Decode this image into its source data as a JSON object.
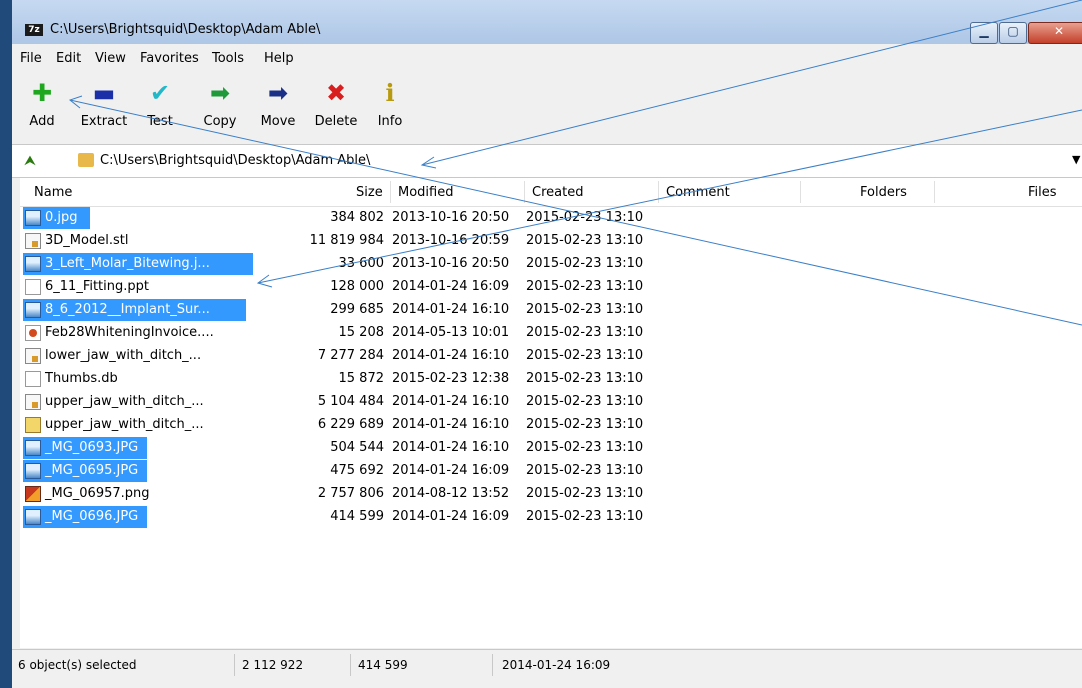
{
  "window": {
    "title": "C:\\Users\\Brightsquid\\Desktop\\Adam Able\\",
    "app_icon": "7z"
  },
  "menu": [
    "File",
    "Edit",
    "View",
    "Favorites",
    "Tools",
    "Help"
  ],
  "toolbar": [
    {
      "label": "Add",
      "icon": "plus-icon",
      "glyph": "✚",
      "color": "#1fa81f"
    },
    {
      "label": "Extract",
      "icon": "minus-icon",
      "glyph": "▬",
      "color": "#1a2fa8"
    },
    {
      "label": "Test",
      "icon": "check-icon",
      "glyph": "✔",
      "color": "#22b8c8"
    },
    {
      "label": "Copy",
      "icon": "copy-arrow-icon",
      "glyph": "➡",
      "color": "#1f9a3a"
    },
    {
      "label": "Move",
      "icon": "move-arrow-icon",
      "glyph": "➡",
      "color": "#1a2f88"
    },
    {
      "label": "Delete",
      "icon": "delete-x-icon",
      "glyph": "✖",
      "color": "#d81e1e"
    },
    {
      "label": "Info",
      "icon": "info-icon",
      "glyph": "ℹ",
      "color": "#b89a10"
    }
  ],
  "address": {
    "path": "C:\\Users\\Brightsquid\\Desktop\\Adam Able\\"
  },
  "columns": [
    "Name",
    "Size",
    "Modified",
    "Created",
    "Comment",
    "Folders",
    "Files"
  ],
  "files": [
    {
      "name": "0.jpg",
      "size": "384 802",
      "modified": "2013-10-16 20:50",
      "created": "2015-02-23 13:10",
      "type": "jpg",
      "selected": true
    },
    {
      "name": "3D_Model.stl",
      "size": "11 819 984",
      "modified": "2013-10-16 20:59",
      "created": "2015-02-23 13:10",
      "type": "stl",
      "selected": false
    },
    {
      "name": "3_Left_Molar_Bitewing.j...",
      "size": "33 600",
      "modified": "2013-10-16 20:50",
      "created": "2015-02-23 13:10",
      "type": "jpg",
      "selected": true
    },
    {
      "name": "6_11_Fitting.ppt",
      "size": "128 000",
      "modified": "2014-01-24 16:09",
      "created": "2015-02-23 13:10",
      "type": "ppt",
      "selected": false
    },
    {
      "name": "8_6_2012__Implant_Sur...",
      "size": "299 685",
      "modified": "2014-01-24 16:10",
      "created": "2015-02-23 13:10",
      "type": "jpg",
      "selected": true
    },
    {
      "name": "Feb28WhiteningInvoice....",
      "size": "15 208",
      "modified": "2014-05-13 10:01",
      "created": "2015-02-23 13:10",
      "type": "pdf",
      "selected": false
    },
    {
      "name": "lower_jaw_with_ditch_...",
      "size": "7 277 284",
      "modified": "2014-01-24 16:10",
      "created": "2015-02-23 13:10",
      "type": "stl",
      "selected": false
    },
    {
      "name": "Thumbs.db",
      "size": "15 872",
      "modified": "2015-02-23 12:38",
      "created": "2015-02-23 13:10",
      "type": "db",
      "selected": false
    },
    {
      "name": "upper_jaw_with_ditch_...",
      "size": "5 104 484",
      "modified": "2014-01-24 16:10",
      "created": "2015-02-23 13:10",
      "type": "stl",
      "selected": false
    },
    {
      "name": "upper_jaw_with_ditch_...",
      "size": "6 229 689",
      "modified": "2014-01-24 16:10",
      "created": "2015-02-23 13:10",
      "type": "zip",
      "selected": false
    },
    {
      "name": "_MG_0693.JPG",
      "size": "504 544",
      "modified": "2014-01-24 16:10",
      "created": "2015-02-23 13:10",
      "type": "jpg",
      "selected": true
    },
    {
      "name": "_MG_0695.JPG",
      "size": "475 692",
      "modified": "2014-01-24 16:09",
      "created": "2015-02-23 13:10",
      "type": "jpg",
      "selected": true
    },
    {
      "name": "_MG_06957.png",
      "size": "2 757 806",
      "modified": "2014-08-12 13:52",
      "created": "2015-02-23 13:10",
      "type": "png",
      "selected": false
    },
    {
      "name": "_MG_0696.JPG",
      "size": "414 599",
      "modified": "2014-01-24 16:09",
      "created": "2015-02-23 13:10",
      "type": "jpg",
      "selected": true
    }
  ],
  "status": {
    "selected": "6 object(s) selected",
    "total_size": "2 112 922",
    "selected_size": "414 599",
    "date": "2014-01-24 16:09"
  },
  "colors": {
    "selection": "#3399ff",
    "annotation_line": "#3a7fc8"
  }
}
